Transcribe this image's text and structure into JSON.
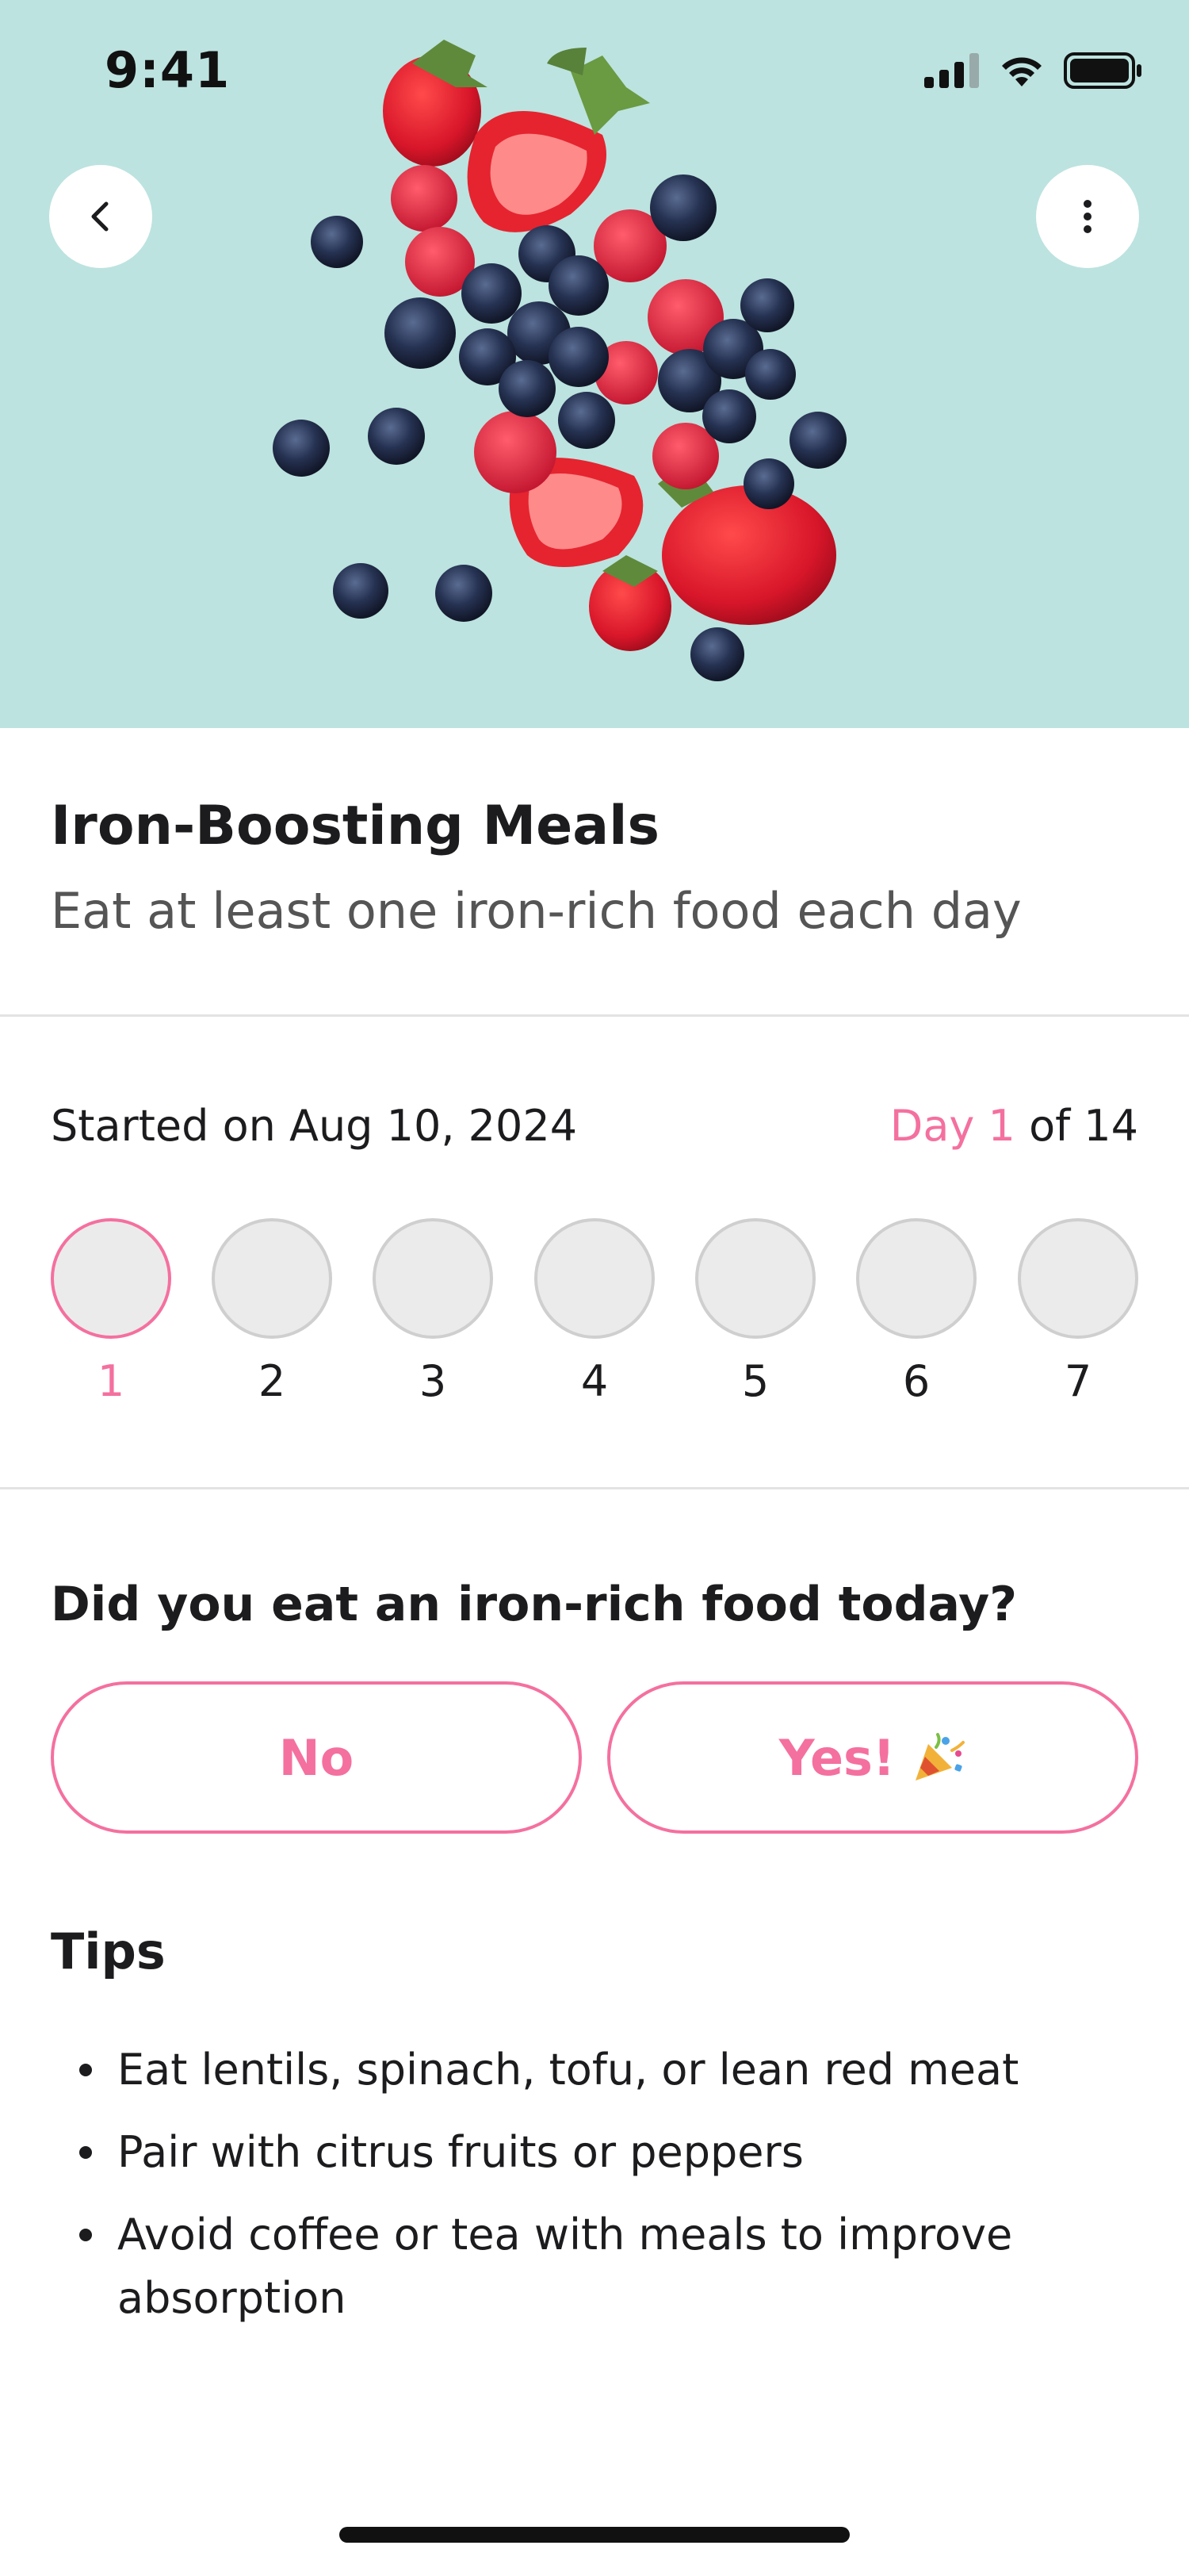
{
  "status_bar": {
    "time": "9:41"
  },
  "hero": {
    "image": "mixed-berries-photo",
    "background": "#bce3df"
  },
  "title": "Iron-Boosting Meals",
  "subtitle": "Eat at least one iron-rich food each day",
  "progress": {
    "started": "Started on Aug 10, 2024",
    "day_prefix": "Day 1",
    "day_suffix": " of 14",
    "days": [
      "1",
      "2",
      "3",
      "4",
      "5",
      "6",
      "7"
    ],
    "current_day": 1
  },
  "question": "Did you eat an iron-rich food today?",
  "answers": {
    "no": "No",
    "yes": "Yes!"
  },
  "tips": {
    "heading": "Tips",
    "items": [
      "Eat lentils, spinach, tofu, or lean red meat",
      "Pair with citrus fruits or peppers",
      "Avoid coffee or tea with meals to improve absorption"
    ]
  },
  "colors": {
    "accent": "#f4709f",
    "hero_bg": "#bce3df"
  }
}
